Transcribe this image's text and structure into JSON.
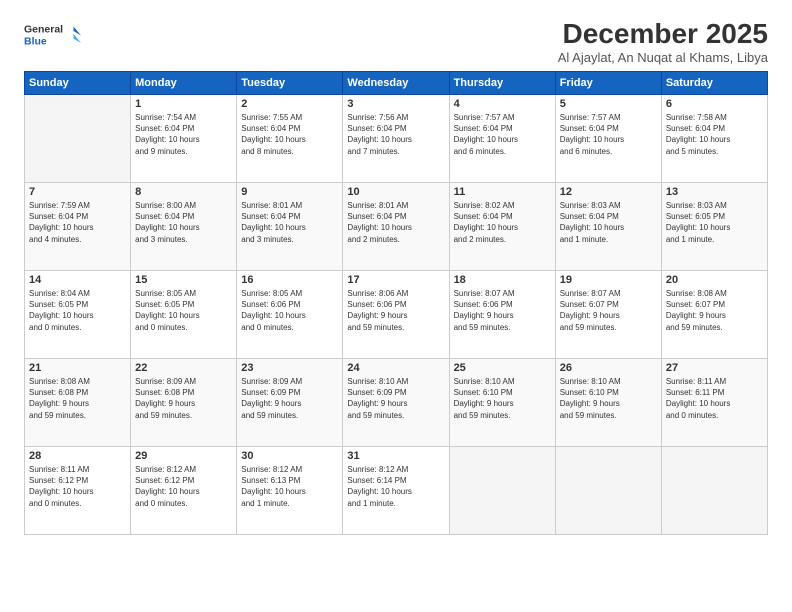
{
  "logo": {
    "line1": "General",
    "line2": "Blue"
  },
  "title": "December 2025",
  "subtitle": "Al Ajaylat, An Nuqat al Khams, Libya",
  "weekdays": [
    "Sunday",
    "Monday",
    "Tuesday",
    "Wednesday",
    "Thursday",
    "Friday",
    "Saturday"
  ],
  "weeks": [
    [
      {
        "day": "",
        "info": ""
      },
      {
        "day": "1",
        "info": "Sunrise: 7:54 AM\nSunset: 6:04 PM\nDaylight: 10 hours\nand 9 minutes."
      },
      {
        "day": "2",
        "info": "Sunrise: 7:55 AM\nSunset: 6:04 PM\nDaylight: 10 hours\nand 8 minutes."
      },
      {
        "day": "3",
        "info": "Sunrise: 7:56 AM\nSunset: 6:04 PM\nDaylight: 10 hours\nand 7 minutes."
      },
      {
        "day": "4",
        "info": "Sunrise: 7:57 AM\nSunset: 6:04 PM\nDaylight: 10 hours\nand 6 minutes."
      },
      {
        "day": "5",
        "info": "Sunrise: 7:57 AM\nSunset: 6:04 PM\nDaylight: 10 hours\nand 6 minutes."
      },
      {
        "day": "6",
        "info": "Sunrise: 7:58 AM\nSunset: 6:04 PM\nDaylight: 10 hours\nand 5 minutes."
      }
    ],
    [
      {
        "day": "7",
        "info": "Sunrise: 7:59 AM\nSunset: 6:04 PM\nDaylight: 10 hours\nand 4 minutes."
      },
      {
        "day": "8",
        "info": "Sunrise: 8:00 AM\nSunset: 6:04 PM\nDaylight: 10 hours\nand 3 minutes."
      },
      {
        "day": "9",
        "info": "Sunrise: 8:01 AM\nSunset: 6:04 PM\nDaylight: 10 hours\nand 3 minutes."
      },
      {
        "day": "10",
        "info": "Sunrise: 8:01 AM\nSunset: 6:04 PM\nDaylight: 10 hours\nand 2 minutes."
      },
      {
        "day": "11",
        "info": "Sunrise: 8:02 AM\nSunset: 6:04 PM\nDaylight: 10 hours\nand 2 minutes."
      },
      {
        "day": "12",
        "info": "Sunrise: 8:03 AM\nSunset: 6:04 PM\nDaylight: 10 hours\nand 1 minute."
      },
      {
        "day": "13",
        "info": "Sunrise: 8:03 AM\nSunset: 6:05 PM\nDaylight: 10 hours\nand 1 minute."
      }
    ],
    [
      {
        "day": "14",
        "info": "Sunrise: 8:04 AM\nSunset: 6:05 PM\nDaylight: 10 hours\nand 0 minutes."
      },
      {
        "day": "15",
        "info": "Sunrise: 8:05 AM\nSunset: 6:05 PM\nDaylight: 10 hours\nand 0 minutes."
      },
      {
        "day": "16",
        "info": "Sunrise: 8:05 AM\nSunset: 6:06 PM\nDaylight: 10 hours\nand 0 minutes."
      },
      {
        "day": "17",
        "info": "Sunrise: 8:06 AM\nSunset: 6:06 PM\nDaylight: 9 hours\nand 59 minutes."
      },
      {
        "day": "18",
        "info": "Sunrise: 8:07 AM\nSunset: 6:06 PM\nDaylight: 9 hours\nand 59 minutes."
      },
      {
        "day": "19",
        "info": "Sunrise: 8:07 AM\nSunset: 6:07 PM\nDaylight: 9 hours\nand 59 minutes."
      },
      {
        "day": "20",
        "info": "Sunrise: 8:08 AM\nSunset: 6:07 PM\nDaylight: 9 hours\nand 59 minutes."
      }
    ],
    [
      {
        "day": "21",
        "info": "Sunrise: 8:08 AM\nSunset: 6:08 PM\nDaylight: 9 hours\nand 59 minutes."
      },
      {
        "day": "22",
        "info": "Sunrise: 8:09 AM\nSunset: 6:08 PM\nDaylight: 9 hours\nand 59 minutes."
      },
      {
        "day": "23",
        "info": "Sunrise: 8:09 AM\nSunset: 6:09 PM\nDaylight: 9 hours\nand 59 minutes."
      },
      {
        "day": "24",
        "info": "Sunrise: 8:10 AM\nSunset: 6:09 PM\nDaylight: 9 hours\nand 59 minutes."
      },
      {
        "day": "25",
        "info": "Sunrise: 8:10 AM\nSunset: 6:10 PM\nDaylight: 9 hours\nand 59 minutes."
      },
      {
        "day": "26",
        "info": "Sunrise: 8:10 AM\nSunset: 6:10 PM\nDaylight: 9 hours\nand 59 minutes."
      },
      {
        "day": "27",
        "info": "Sunrise: 8:11 AM\nSunset: 6:11 PM\nDaylight: 10 hours\nand 0 minutes."
      }
    ],
    [
      {
        "day": "28",
        "info": "Sunrise: 8:11 AM\nSunset: 6:12 PM\nDaylight: 10 hours\nand 0 minutes."
      },
      {
        "day": "29",
        "info": "Sunrise: 8:12 AM\nSunset: 6:12 PM\nDaylight: 10 hours\nand 0 minutes."
      },
      {
        "day": "30",
        "info": "Sunrise: 8:12 AM\nSunset: 6:13 PM\nDaylight: 10 hours\nand 1 minute."
      },
      {
        "day": "31",
        "info": "Sunrise: 8:12 AM\nSunset: 6:14 PM\nDaylight: 10 hours\nand 1 minute."
      },
      {
        "day": "",
        "info": ""
      },
      {
        "day": "",
        "info": ""
      },
      {
        "day": "",
        "info": ""
      }
    ]
  ]
}
